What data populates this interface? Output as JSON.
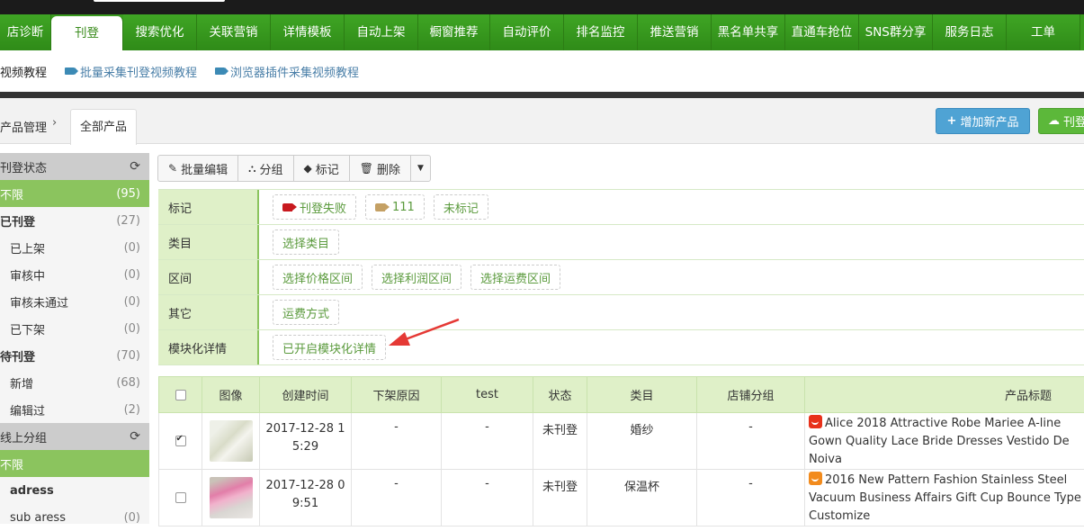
{
  "nav": {
    "tabs": [
      "店诊断",
      "刊登",
      "搜索优化",
      "关联营销",
      "详情模板",
      "自动上架",
      "橱窗推荐",
      "自动评价",
      "排名监控",
      "推送营销",
      "黑名单共享",
      "直通车抢位",
      "SNS群分享",
      "服务日志",
      "工单"
    ],
    "active": "刊登"
  },
  "subnav": {
    "tutorial": "视频教程",
    "batch_video": "批量采集刊登视频教程",
    "plugin_video": "浏览器插件采集视频教程"
  },
  "breadcrumb": {
    "parent": "产品管理",
    "current": "全部产品",
    "chevron": "›"
  },
  "actions": {
    "add_product": "增加新产品",
    "publish": "刊登"
  },
  "sidebar": {
    "publish_status_title": "刊登状态",
    "status_items": [
      {
        "label": "不限",
        "count": "(95)",
        "active": true,
        "bold": false,
        "sub": false
      },
      {
        "label": "已刊登",
        "count": "(27)",
        "active": false,
        "bold": true,
        "sub": false
      },
      {
        "label": "已上架",
        "count": "(0)",
        "active": false,
        "bold": false,
        "sub": true
      },
      {
        "label": "审核中",
        "count": "(0)",
        "active": false,
        "bold": false,
        "sub": true
      },
      {
        "label": "审核未通过",
        "count": "(0)",
        "active": false,
        "bold": false,
        "sub": true
      },
      {
        "label": "已下架",
        "count": "(0)",
        "active": false,
        "bold": false,
        "sub": true
      },
      {
        "label": "待刊登",
        "count": "(70)",
        "active": false,
        "bold": true,
        "sub": false
      },
      {
        "label": "新增",
        "count": "(68)",
        "active": false,
        "bold": false,
        "sub": true
      },
      {
        "label": "编辑过",
        "count": "(2)",
        "active": false,
        "bold": false,
        "sub": true
      }
    ],
    "group_title": "线上分组",
    "group_items": [
      {
        "label": "不限",
        "count": "",
        "active": true,
        "bold": false,
        "sub": false
      },
      {
        "label": "adress",
        "count": "",
        "active": false,
        "bold": true,
        "sub": true
      },
      {
        "label": "sub aress",
        "count": "(0)",
        "active": false,
        "bold": false,
        "sub": true
      }
    ]
  },
  "toolbar": {
    "batch_edit": "批量编辑",
    "group": "分组",
    "mark": "标记",
    "delete": "删除"
  },
  "filters": [
    {
      "label": "标记",
      "chips": [
        {
          "text": "刊登失败",
          "tag": "red"
        },
        {
          "text": "111",
          "tag": "tan"
        },
        {
          "text": "未标记",
          "tag": ""
        }
      ]
    },
    {
      "label": "类目",
      "chips": [
        {
          "text": "选择类目",
          "tag": ""
        }
      ]
    },
    {
      "label": "区间",
      "chips": [
        {
          "text": "选择价格区间",
          "tag": ""
        },
        {
          "text": "选择利润区间",
          "tag": ""
        },
        {
          "text": "选择运费区间",
          "tag": ""
        }
      ]
    },
    {
      "label": "其它",
      "chips": [
        {
          "text": "运费方式",
          "tag": ""
        }
      ]
    },
    {
      "label": "模块化详情",
      "chips": [
        {
          "text": "已开启模块化详情",
          "tag": ""
        }
      ]
    }
  ],
  "table": {
    "headers": [
      "",
      "图像",
      "创建时间",
      "下架原因",
      "test",
      "状态",
      "类目",
      "店铺分组",
      "产品标题"
    ],
    "rows": [
      {
        "checked": true,
        "image": "dress",
        "created": "2017-12-28 15:29",
        "reason": "-",
        "test": "-",
        "status": "未刊登",
        "category": "婚纱",
        "group": "-",
        "icon": "red",
        "title": "Alice 2018 Attractive Robe Mariee A-line Gown Quality Lace Bride Dresses Vestido De Noiva"
      },
      {
        "checked": false,
        "image": "bottle",
        "created": "2017-12-28 09:51",
        "reason": "-",
        "test": "-",
        "status": "未刊登",
        "category": "保温杯",
        "group": "-",
        "icon": "orange",
        "title": "2016 New Pattern Fashion Stainless Steel Vacuum Business Affairs Gift Cup Bounce Type Customize"
      }
    ]
  },
  "colors": {
    "nav_green": "#3a9a1f",
    "accent_green": "#8bc45e",
    "panel_green": "#dff0c8",
    "chip_text": "#5a9a3c",
    "add_blue": "#4fa3d4",
    "arrow_red": "#e53935"
  }
}
